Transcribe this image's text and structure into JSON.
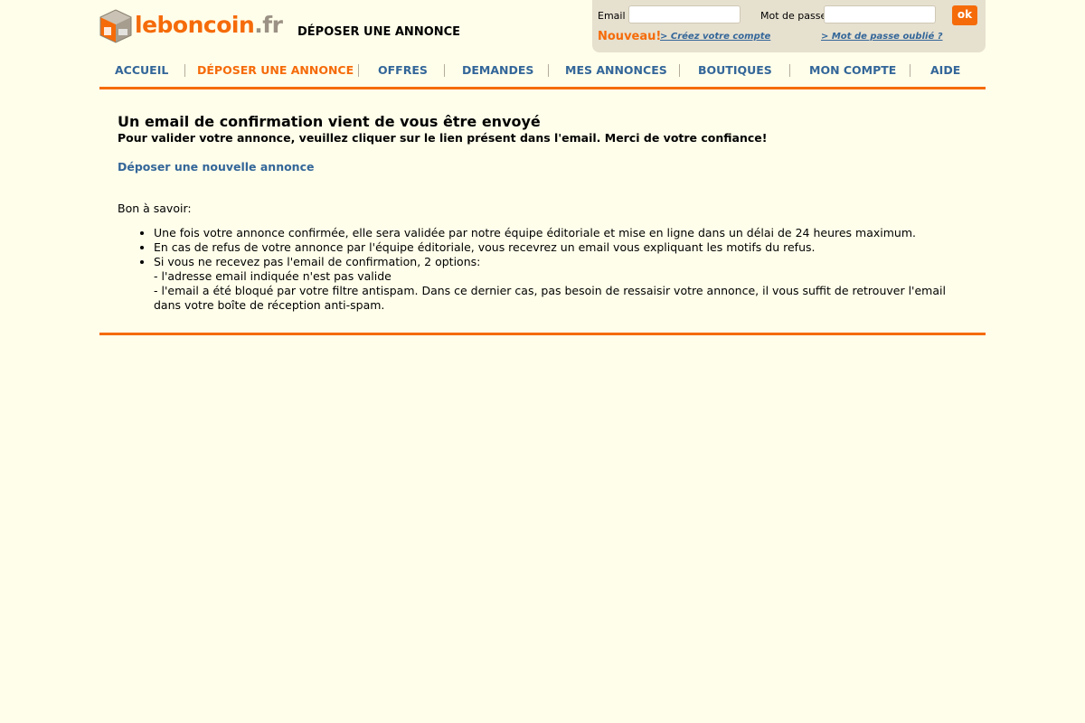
{
  "logo": {
    "brand": "leboncoin",
    "tld": ".fr"
  },
  "page_heading": "DÉPOSER UNE ANNONCE",
  "login": {
    "email_label": "Email",
    "email_value": "",
    "password_label": "Mot de passe",
    "password_value": "",
    "ok_label": "ok",
    "nouveau": "Nouveau!",
    "create_account": "> Créez votre compte",
    "forgot_password": "> Mot de passe oublié ?"
  },
  "nav": {
    "items": [
      {
        "label": "ACCUEIL"
      },
      {
        "label": "DÉPOSER UNE ANNONCE"
      },
      {
        "label": "OFFRES"
      },
      {
        "label": "DEMANDES"
      },
      {
        "label": "MES ANNONCES"
      },
      {
        "label": "BOUTIQUES"
      },
      {
        "label": "MON COMPTE"
      },
      {
        "label": "AIDE"
      }
    ],
    "active_index": 1
  },
  "content": {
    "title": "Un email de confirmation vient de vous être envoyé",
    "subtitle": "Pour valider votre annonce, veuillez cliquer sur le lien présent dans l'email. Merci de votre confiance!",
    "new_ad_link": "Déposer une nouvelle annonce",
    "bon_a_savoir": "Bon à savoir:",
    "tips": [
      "Une fois votre annonce confirmée, elle sera validée par notre équipe éditoriale et mise en ligne dans un délai de 24 heures maximum.",
      "En cas de refus de votre annonce par l'équipe éditoriale, vous recevrez un email vous expliquant les motifs du refus.",
      "Si vous ne recevez pas l'email de confirmation, 2 options:"
    ],
    "tip_options": [
      "- l'adresse email indiquée n'est pas valide",
      "- l'email a été bloqué par votre filtre antispam. Dans ce dernier cas, pas besoin de ressaisir votre annonce, il vous suffit de retrouver l'email dans votre boîte de réception anti-spam."
    ]
  },
  "colors": {
    "accent": "#f56b0a",
    "link": "#336699",
    "background": "#fffeea",
    "login_box": "#e6e0cf"
  }
}
